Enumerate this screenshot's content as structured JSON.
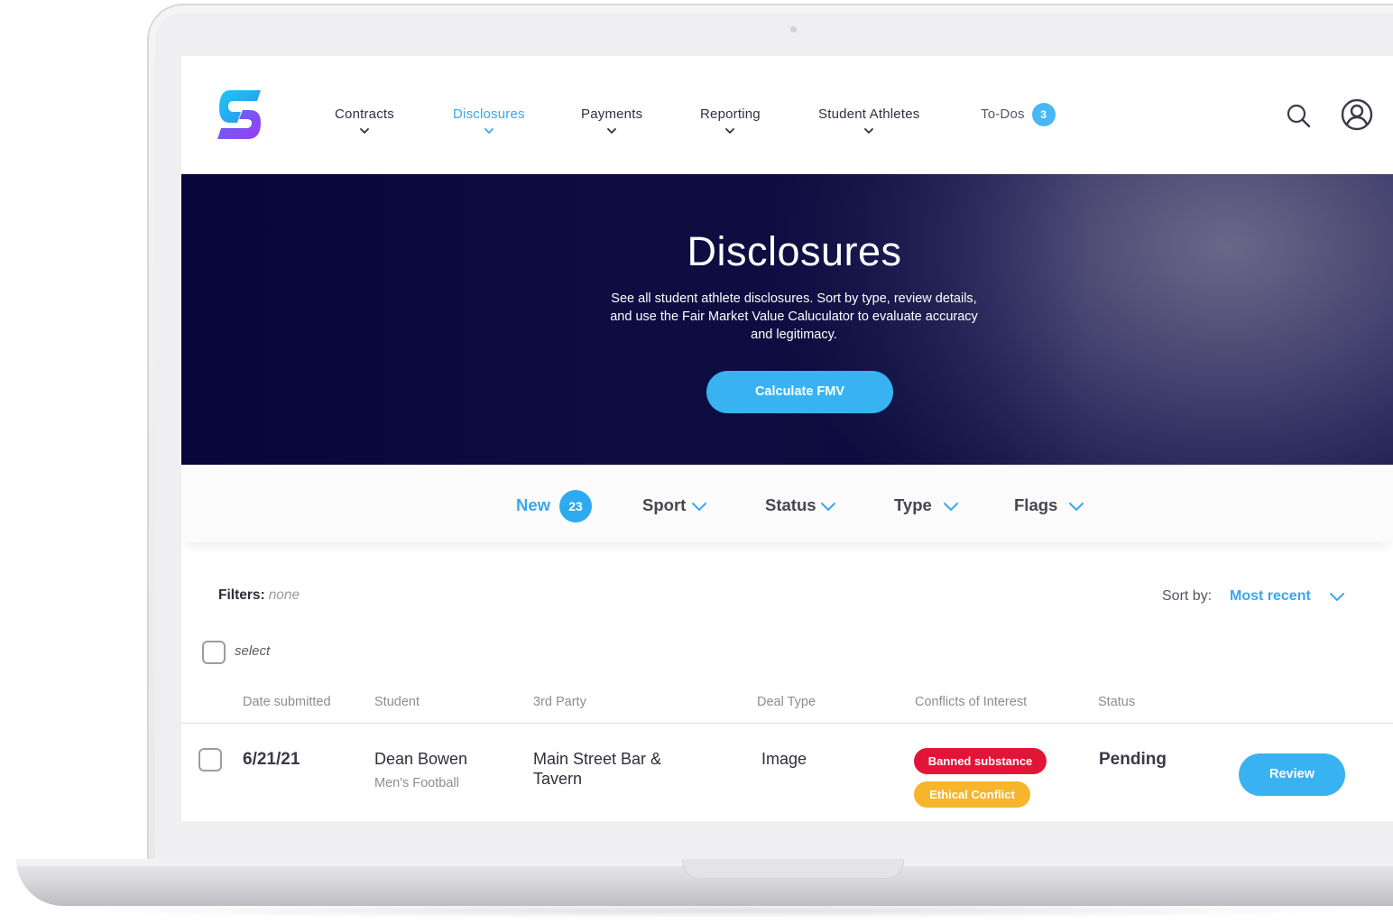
{
  "nav": {
    "items": [
      {
        "label": "Contracts"
      },
      {
        "label": "Disclosures"
      },
      {
        "label": "Payments"
      },
      {
        "label": "Reporting"
      },
      {
        "label": "Student Athletes"
      }
    ],
    "todos": {
      "label": "To-Dos",
      "count": "3"
    },
    "active": "Disclosures"
  },
  "icons": {
    "logo": "brand-logo-s",
    "search": "search-icon",
    "account": "user-circle-icon",
    "chevron": "chevron-down-icon"
  },
  "hero": {
    "title": "Disclosures",
    "description": "See all student athlete disclosures. Sort by type, review details, and use the Fair Market Value Caluculator to evaluate accuracy and legitimacy.",
    "cta": "Calculate FMV"
  },
  "filterbar": {
    "new": {
      "label": "New",
      "count": "23"
    },
    "sport": "Sport",
    "status": "Status",
    "type": "Type",
    "flags": "Flags"
  },
  "filters": {
    "label": "Filters:",
    "value": "none"
  },
  "sort": {
    "label": "Sort by:",
    "value": "Most recent"
  },
  "select_all": "select",
  "table": {
    "headers": [
      "Date submitted",
      "Student",
      "3rd Party",
      "Deal Type",
      "Conflicts of Interest",
      "Status"
    ],
    "rows": [
      {
        "date": "6/21/21",
        "student": "Dean Bowen",
        "student_team": "Men's Football",
        "third_party_line1": "Main Street Bar &",
        "third_party_line2": "Tavern",
        "deal_type": "Image",
        "conflicts": [
          "Banned substance",
          "Ethical Conflict"
        ],
        "status": "Pending",
        "action": "Review"
      }
    ]
  },
  "colors": {
    "accent": "#39b2f2",
    "hero_dark": "#070735",
    "conflict_red": "#e21539",
    "conflict_yellow": "#f6b52a"
  }
}
